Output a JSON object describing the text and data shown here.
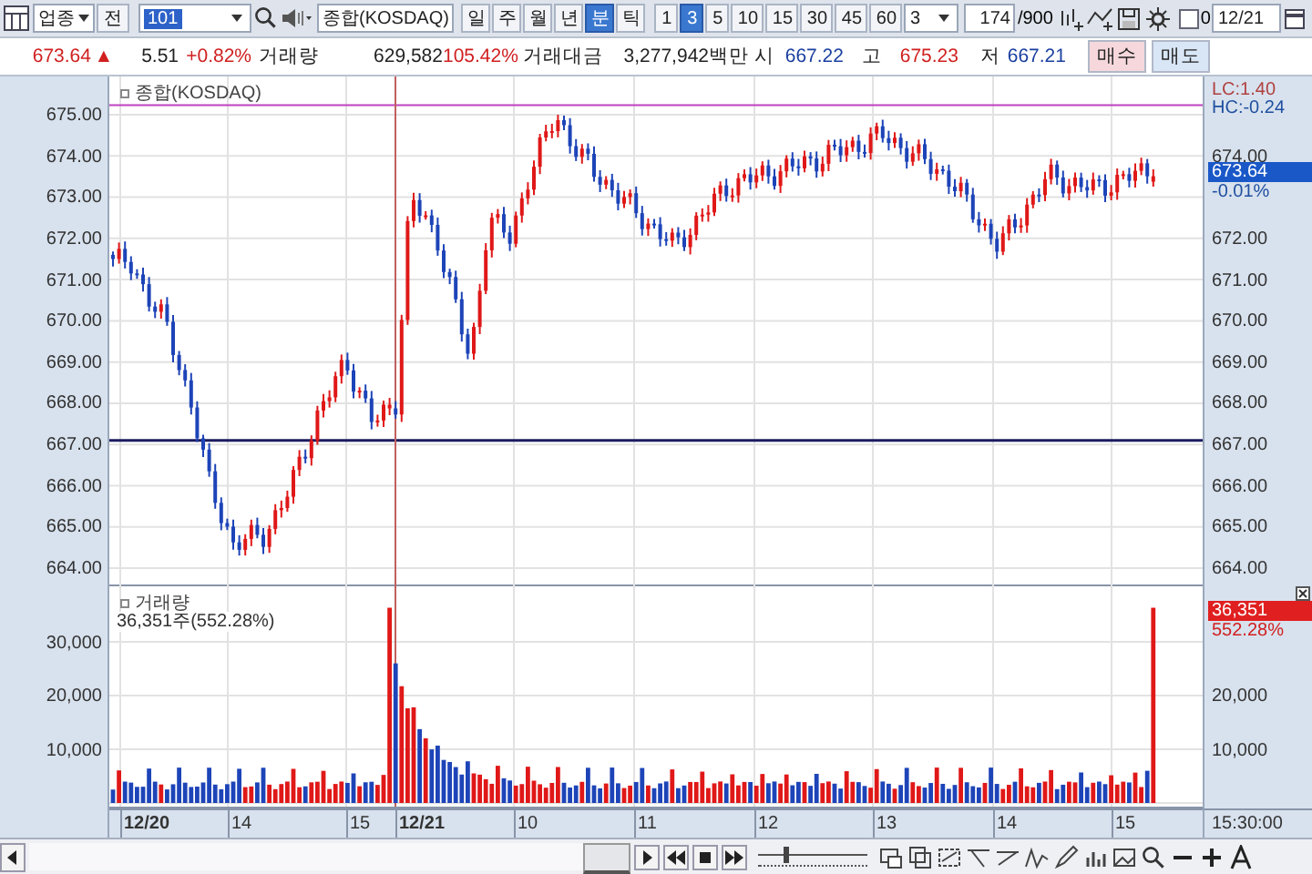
{
  "toolbar": {
    "market_select": "업종",
    "mode_button": "전",
    "code_field": "101",
    "name_field": "종합(KOSDAQ)",
    "period_tabs": [
      {
        "label": "일",
        "selected": false
      },
      {
        "label": "주",
        "selected": false
      },
      {
        "label": "월",
        "selected": false
      },
      {
        "label": "년",
        "selected": false
      },
      {
        "label": "분",
        "selected": true
      },
      {
        "label": "틱",
        "selected": false
      }
    ],
    "interval_tabs": [
      {
        "label": "1",
        "selected": false
      },
      {
        "label": "3",
        "selected": true
      },
      {
        "label": "5",
        "selected": false
      },
      {
        "label": "10",
        "selected": false
      },
      {
        "label": "15",
        "selected": false
      },
      {
        "label": "30",
        "selected": false
      },
      {
        "label": "45",
        "selected": false
      },
      {
        "label": "60",
        "selected": false
      }
    ],
    "interval_select": "3",
    "count_field": "174",
    "count_total": "/900",
    "checkbox": {
      "label": "0",
      "checked": false
    },
    "date_field": "12/21"
  },
  "quote": {
    "price": "673.64",
    "change_mark": "▲",
    "change": "5.51",
    "change_pct": "+0.82%",
    "volume_label": "거래량",
    "volume": "629,582",
    "volume_ratio": "105.42%",
    "amount_label": "거래대금",
    "amount": "3,277,942백만",
    "open_label": "시",
    "open": "667.22",
    "high_label": "고",
    "high": "675.23",
    "low_label": "저",
    "low": "667.21",
    "buy_button": "매수",
    "sell_button": "매도"
  },
  "price_pane": {
    "legend": "종합(KOSDAQ)",
    "lc": "LC:1.40",
    "hc": "HC:-0.24",
    "left_ticks": [
      "675.00",
      "674.00",
      "673.00",
      "672.00",
      "671.00",
      "670.00",
      "669.00",
      "668.00",
      "667.00",
      "666.00",
      "665.00",
      "664.00"
    ],
    "right_ticks": [
      "674.00",
      "672.00",
      "671.00",
      "670.00",
      "669.00",
      "668.00",
      "667.00",
      "666.00",
      "665.00",
      "664.00"
    ],
    "current_price": "673.64",
    "current_change": "-0.01%"
  },
  "volume_pane": {
    "legend": "거래량",
    "legend_value": "36,351주(552.28%)",
    "left_ticks": [
      "30,000",
      "20,000",
      "10,000"
    ],
    "right_ticks": [
      "20,000",
      "10,000"
    ],
    "current_volume": "36,351",
    "current_ratio": "552.28%"
  },
  "time_axis": {
    "labels": [
      "12/20",
      "14",
      "15",
      "12/21",
      "10",
      "11",
      "12",
      "13",
      "14",
      "15"
    ],
    "end_time": "15:30:00"
  },
  "bottom_bar": {
    "zoom_slider": {
      "level": 0.25
    }
  }
}
